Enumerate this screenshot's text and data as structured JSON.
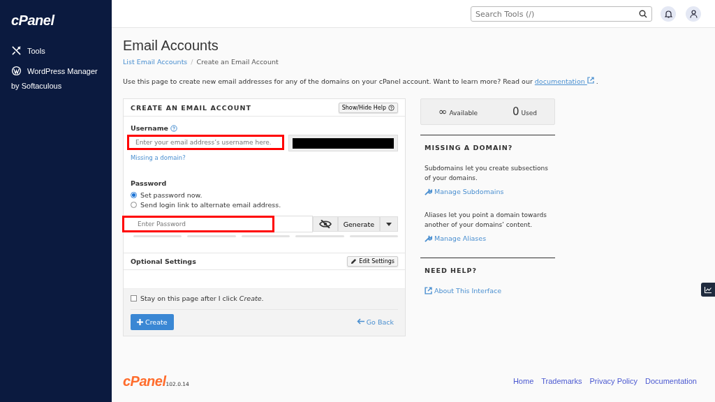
{
  "sidebar": {
    "logo": "cPanel",
    "items": [
      {
        "kind": "tools",
        "label": "Tools"
      },
      {
        "kind": "wordpress",
        "label": "WordPress Manager",
        "sublabel": "by Softaculous"
      }
    ]
  },
  "topbar": {
    "search": {
      "placeholder": "Search Tools (/)"
    }
  },
  "page": {
    "title": "Email Accounts",
    "breadcrumb_separator": "/",
    "breadcrumb": [
      {
        "label": "List Email Accounts",
        "link": true
      },
      {
        "label": "Create an Email Account",
        "link": false
      }
    ],
    "intro": "Use this page to create new email addresses for any of the domains on your cPanel account. Want to learn more? Read our",
    "intro_link": "documentation",
    "intro_end": "."
  },
  "form": {
    "title": "CREATE AN EMAIL ACCOUNT",
    "help_button": "Show/Hide Help",
    "username": {
      "label": "Username",
      "placeholder": "Enter your email address’s username here.",
      "highlighted": true
    },
    "missing_link": "Missing a domain?",
    "password": {
      "label": "Password",
      "options": [
        {
          "label": "Set password now.",
          "selected": true
        },
        {
          "label": "Send login link to alternate email address.",
          "selected": false
        }
      ],
      "placeholder": "Enter Password",
      "highlighted": true,
      "generate": "Generate"
    },
    "optional": {
      "title": "Optional Settings",
      "button": "Edit Settings"
    },
    "stay": {
      "label": "Stay on this page after I click *Create*.",
      "checked": false
    },
    "create": "Create",
    "back": "Go Back"
  },
  "stats": [
    {
      "value": "∞",
      "label": "Available"
    },
    {
      "value": "0",
      "label": "Used"
    }
  ],
  "side": [
    {
      "title": "MISSING A DOMAIN?",
      "blocks": [
        {
          "text": "Subdomains let you create subsections of your domains.",
          "link": "Manage Subdomains",
          "kind": "wrench"
        },
        {
          "text": "Aliases let you point a domain towards another of your domains’ content.",
          "link": "Manage Aliases",
          "kind": "wrench"
        }
      ]
    },
    {
      "title": "NEED HELP?",
      "blocks": [
        {
          "link": "About This Interface",
          "kind": "external"
        }
      ]
    }
  ],
  "footer": {
    "logo": "cPanel",
    "version": "102.0.14",
    "links": [
      "Home",
      "Trademarks",
      "Privacy Policy",
      "Documentation"
    ]
  }
}
